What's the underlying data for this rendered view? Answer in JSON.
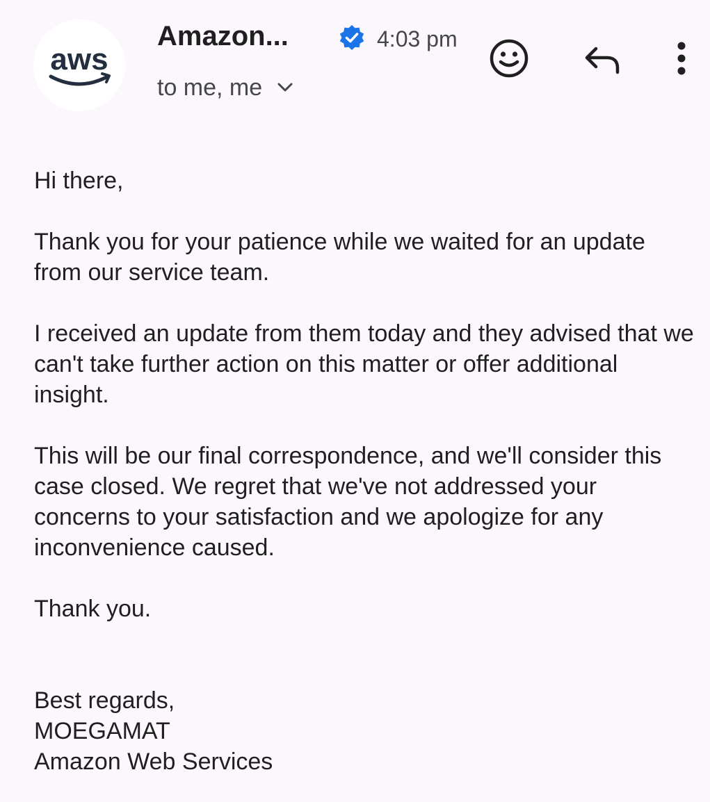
{
  "header": {
    "sender_name": "Amazon...",
    "time": "4:03 pm",
    "recipients": "to me, me",
    "avatar_logo_text": "aws",
    "verified_icon": "verified-badge-icon",
    "actions": {
      "emoji_icon": "smiley-icon",
      "reply_icon": "reply-icon",
      "more_icon": "more-vertical-icon"
    }
  },
  "colors": {
    "background": "#fbf7fc",
    "verified_blue": "#1a73e8",
    "text_primary": "#1f1f1f",
    "text_secondary": "#444746"
  },
  "message": {
    "greeting": "Hi there,",
    "paragraphs": [
      "Thank you for your patience while we waited for an update from our service team.",
      "I received an update from them today and they advised that we can't take further action on this matter or offer additional insight.",
      "This will be our final correspondence, and we'll consider this case closed. We regret that we've not addressed your concerns to your satisfaction and we apologize for any inconvenience caused."
    ],
    "closing": "Thank you.",
    "signature": {
      "regards": "Best regards,",
      "name": "MOEGAMAT",
      "company": "Amazon Web Services"
    }
  }
}
